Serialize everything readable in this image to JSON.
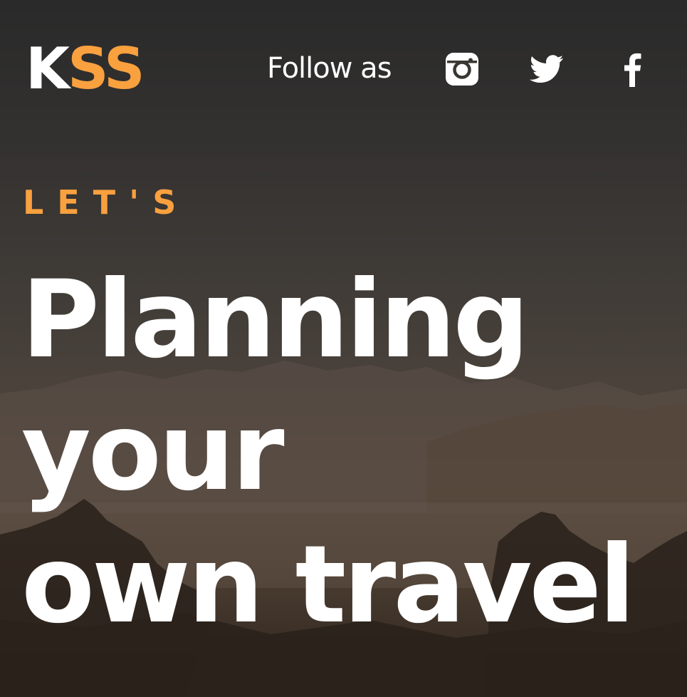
{
  "logo": {
    "part1": "K",
    "part2": "SS"
  },
  "header": {
    "follow_text": "Follow as"
  },
  "social": [
    {
      "icon": "instagram-icon"
    },
    {
      "icon": "twitter-icon"
    },
    {
      "icon": "facebook-icon"
    }
  ],
  "hero": {
    "eyebrow": "LET'S",
    "headline_lines": [
      "Planning",
      "your",
      "own travel"
    ]
  },
  "colors": {
    "accent": "#f9a03f",
    "text": "#ffffff",
    "background": "#2b2b2b"
  }
}
